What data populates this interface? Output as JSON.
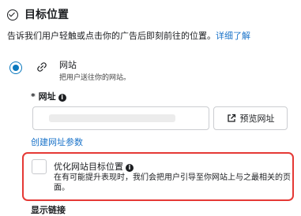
{
  "header": {
    "title": "目标位置",
    "description": "告诉我们用户轻触或点击你的广告后即刻前往的位置。",
    "learn_more": "详细了解"
  },
  "website_option": {
    "title": "网站",
    "subtitle": "把用户送往你的网站。",
    "selected": true
  },
  "url_field": {
    "label": "* 网址",
    "value": "",
    "preview_button": "预览网址",
    "create_params_link": "创建网址参数"
  },
  "optimize": {
    "title": "优化网站目标位置",
    "description": "在有可能提升表现时，我们会把用户引导至你网站上与之最相关的页面。",
    "checked": false
  },
  "bottom_section": {
    "label": "显示链接"
  },
  "colors": {
    "accent": "#0a78be",
    "link": "#1a73c9",
    "highlight_border": "#e53935"
  }
}
